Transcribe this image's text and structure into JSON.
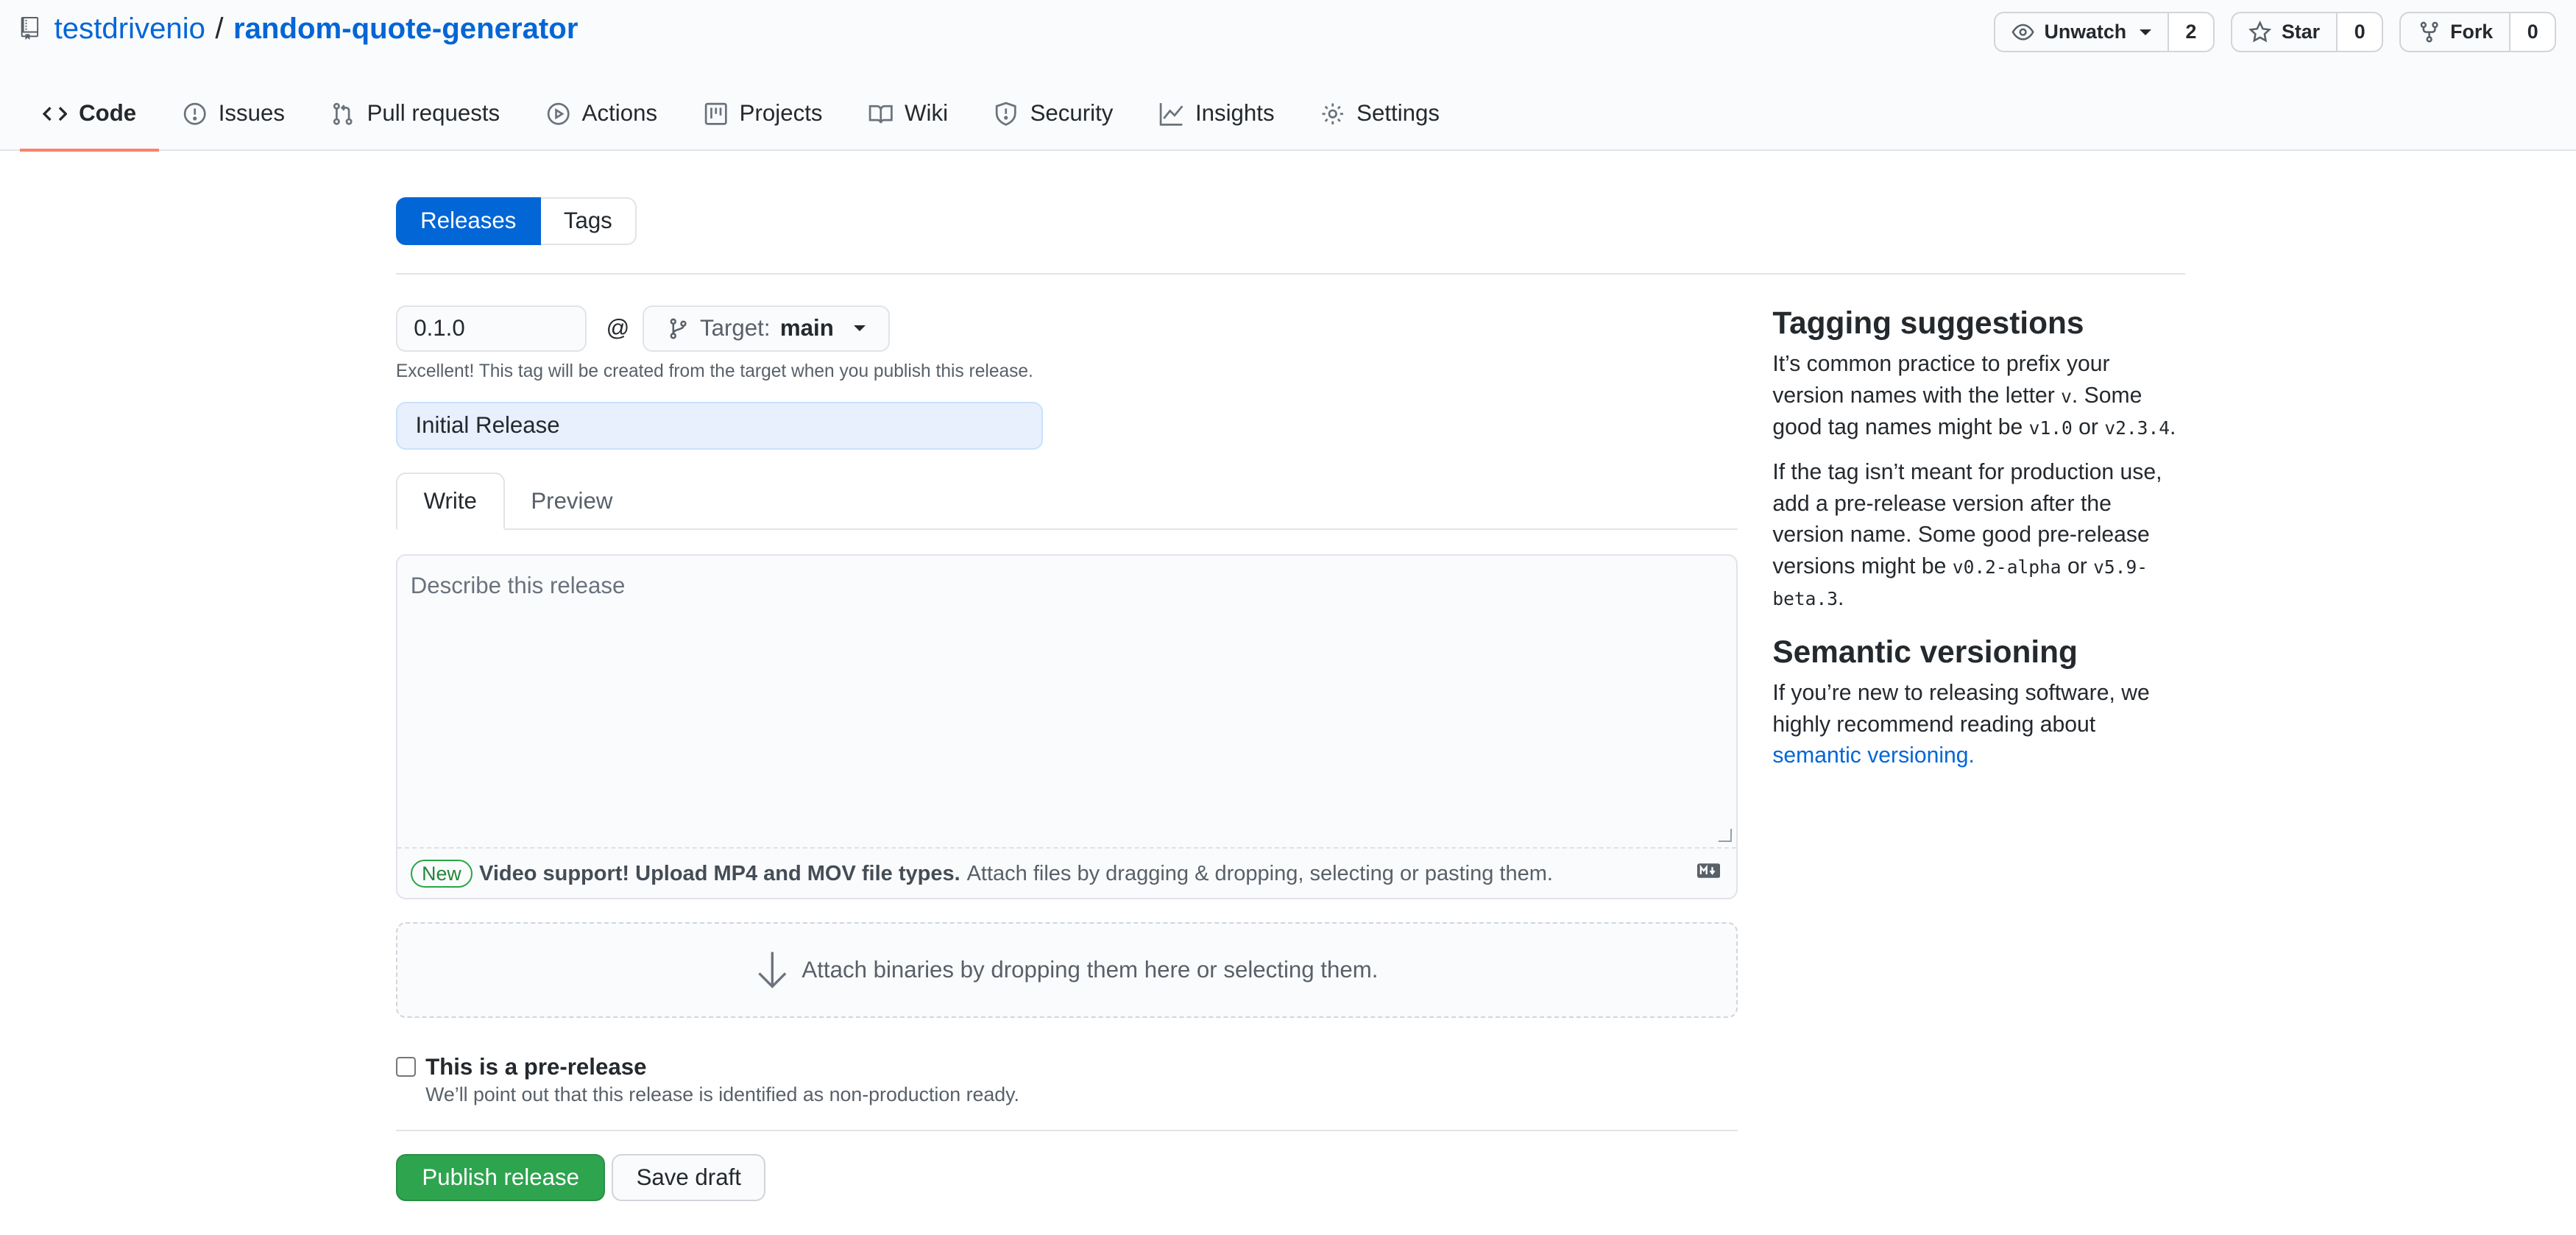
{
  "repo": {
    "owner": "testdrivenio",
    "separator": "/",
    "name": "random-quote-generator"
  },
  "actions": {
    "watch": {
      "label": "Unwatch",
      "count": "2"
    },
    "star": {
      "label": "Star",
      "count": "0"
    },
    "fork": {
      "label": "Fork",
      "count": "0"
    }
  },
  "tabs": [
    {
      "label": "Code",
      "icon": "code-icon"
    },
    {
      "label": "Issues",
      "icon": "issue-icon"
    },
    {
      "label": "Pull requests",
      "icon": "pull-request-icon"
    },
    {
      "label": "Actions",
      "icon": "play-icon"
    },
    {
      "label": "Projects",
      "icon": "project-icon"
    },
    {
      "label": "Wiki",
      "icon": "book-icon"
    },
    {
      "label": "Security",
      "icon": "shield-icon"
    },
    {
      "label": "Insights",
      "icon": "graph-icon"
    },
    {
      "label": "Settings",
      "icon": "gear-icon"
    }
  ],
  "subnav": {
    "releases": "Releases",
    "tags": "Tags"
  },
  "form": {
    "tag_value": "0.1.0",
    "at": "@",
    "target_label": "Target:",
    "target_value": "main",
    "tag_note": "Excellent! This tag will be created from the target when you publish this release.",
    "title_value": "Initial Release",
    "write_tab": "Write",
    "preview_tab": "Preview",
    "description_placeholder": "Describe this release",
    "new_badge": "New",
    "video_support": "Video support! Upload MP4 and MOV file types.",
    "attach_hint": "Attach files by dragging & dropping, selecting or pasting them.",
    "dropzone_text": "Attach binaries by dropping them here or selecting them.",
    "prerelease_label": "This is a pre-release",
    "prerelease_sub": "We’ll point out that this release is identified as non-production ready.",
    "publish_button": "Publish release",
    "draft_button": "Save draft"
  },
  "sidebar": {
    "tagging_title": "Tagging suggestions",
    "tagging_p1_a": "It’s common practice to prefix your version names with the letter ",
    "tagging_p1_code1": "v",
    "tagging_p1_b": ". Some good tag names might be ",
    "tagging_p1_code2": "v1.0",
    "tagging_p1_c": " or ",
    "tagging_p1_code3": "v2.3.4",
    "tagging_p1_d": ".",
    "tagging_p2_a": "If the tag isn’t meant for production use, add a pre-release version after the version name. Some good pre-release versions might be ",
    "tagging_p2_code1": "v0.2-alpha",
    "tagging_p2_b": " or ",
    "tagging_p2_code2": "v5.9-beta.3",
    "tagging_p2_c": ".",
    "semver_title": "Semantic versioning",
    "semver_text": "If you’re new to releasing software, we highly recommend reading about ",
    "semver_link": "semantic versioning."
  },
  "colors": {
    "link": "#0366d6",
    "primary_button": "#2ea44f",
    "selected_tab_underline": "#f9826c",
    "subnav_active": "#0366d6"
  }
}
